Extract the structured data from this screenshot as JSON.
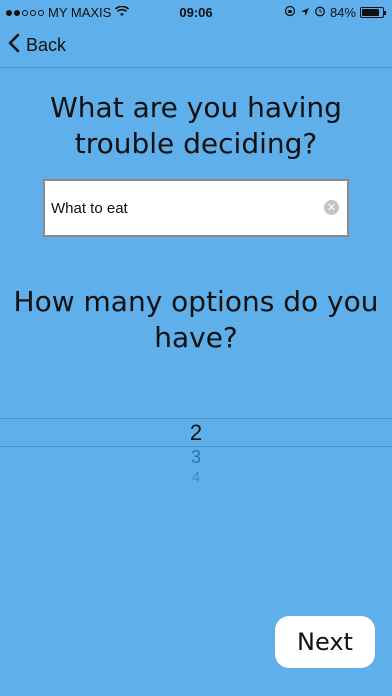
{
  "status_bar": {
    "carrier": "MY MAXIS",
    "time": "09:06",
    "battery_percent": "84%",
    "battery_level": 0.84,
    "signal_bars": 2
  },
  "nav": {
    "back_label": "Back"
  },
  "questions": {
    "decision_question": "What are you having trouble deciding?",
    "options_question": "How many options do you have?"
  },
  "decision_input": {
    "value": "What to eat"
  },
  "options_picker": {
    "selected": "2",
    "next": "3",
    "next2": "4"
  },
  "next_button": {
    "label": "Next"
  },
  "colors": {
    "background": "#5fb0ea",
    "button_bg": "#ffffff"
  }
}
